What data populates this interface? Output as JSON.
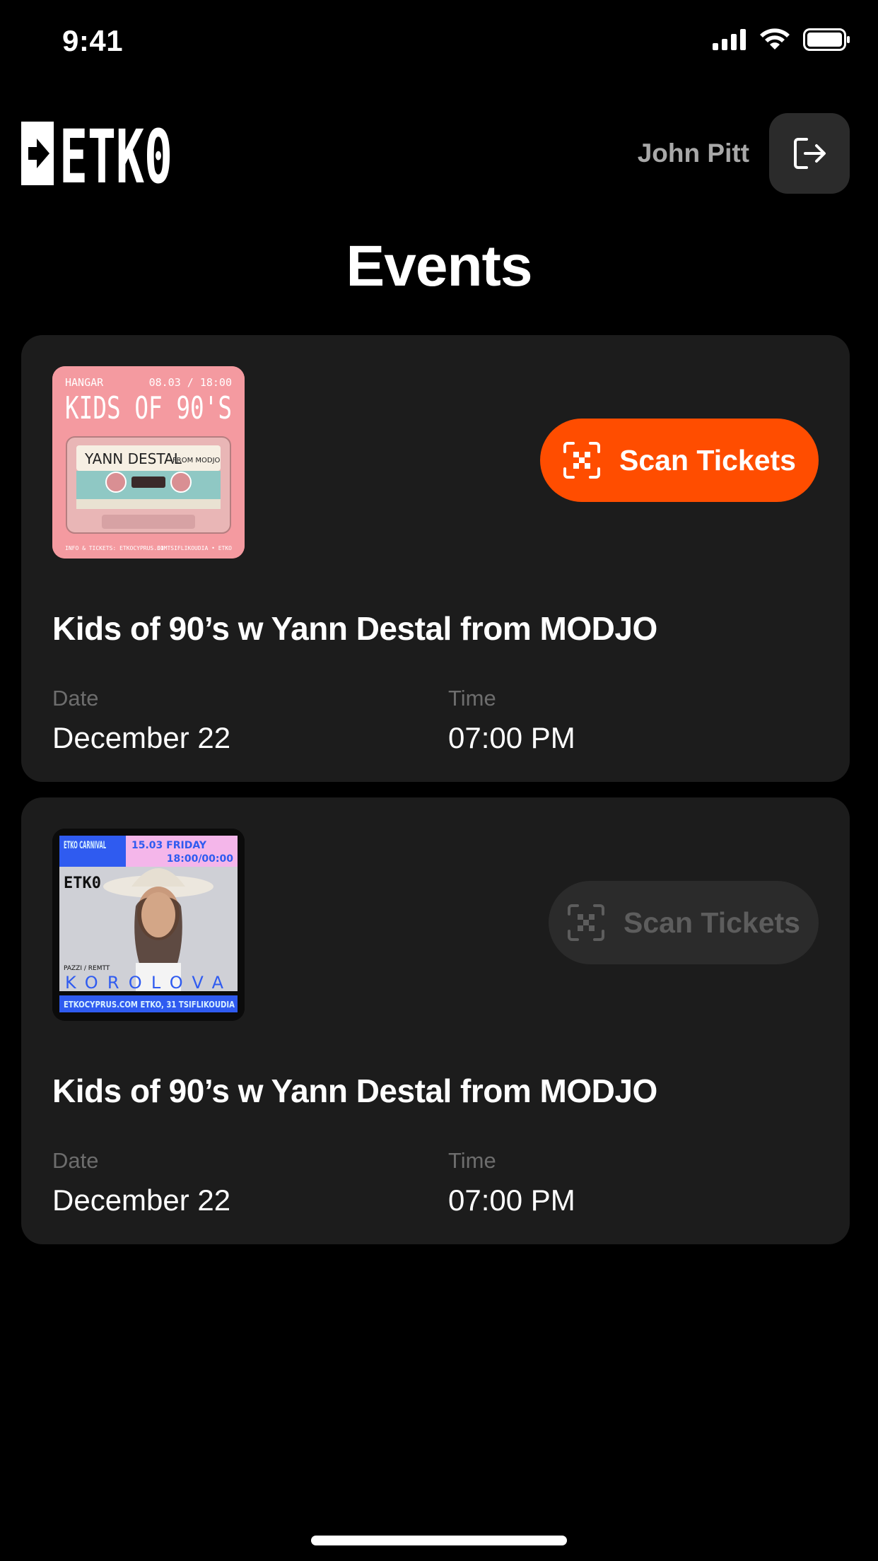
{
  "status_bar": {
    "time": "9:41"
  },
  "header": {
    "logo_text": "ETK0",
    "user_name": "John Pitt"
  },
  "page": {
    "title": "Events"
  },
  "events": [
    {
      "title": "Kids of 90’s w Yann Destal from MODJO",
      "scan_label": "Scan Tickets",
      "scan_enabled": true,
      "date_label": "Date",
      "date_value": "December 22",
      "time_label": "Time",
      "time_value": "07:00 PM",
      "poster": {
        "venue": "HANGAR",
        "datetime": "08.03 / 18:00",
        "headline": "KIDS OF 90'S",
        "cassette_title": "YANN DESTAL",
        "cassette_sub": "FROM MODJO",
        "footer_left": "INFO & TICKETS: ETKOCYPRUS.COM",
        "footer_right": "31 TSIFLIKOUDIA • ETKO"
      }
    },
    {
      "title": "Kids of 90’s w Yann Destal from MODJO",
      "scan_label": "Scan Tickets",
      "scan_enabled": false,
      "date_label": "Date",
      "date_value": "December 22",
      "time_label": "Time",
      "time_value": "07:00 PM",
      "poster": {
        "top_left": "ETKO CARNIVAL",
        "top_right_day": "15.03 FRIDAY",
        "top_right_time": "18:00/00:00",
        "logo": "ETK0",
        "small_text": "PAZZI / REMTT",
        "artist": "KOROLOVA",
        "footer": "ETKOCYPRUS.COM  ETKO, 31 TSIFLIKOUDIA"
      }
    }
  ],
  "colors": {
    "accent": "#ff4d00",
    "card": "#1c1c1c",
    "background": "#000000",
    "muted": "#6d6d6d"
  },
  "icons": {
    "logout": "logout-icon",
    "scan": "scan-qr-icon",
    "signal": "signal-icon",
    "wifi": "wifi-icon",
    "battery": "battery-icon"
  }
}
